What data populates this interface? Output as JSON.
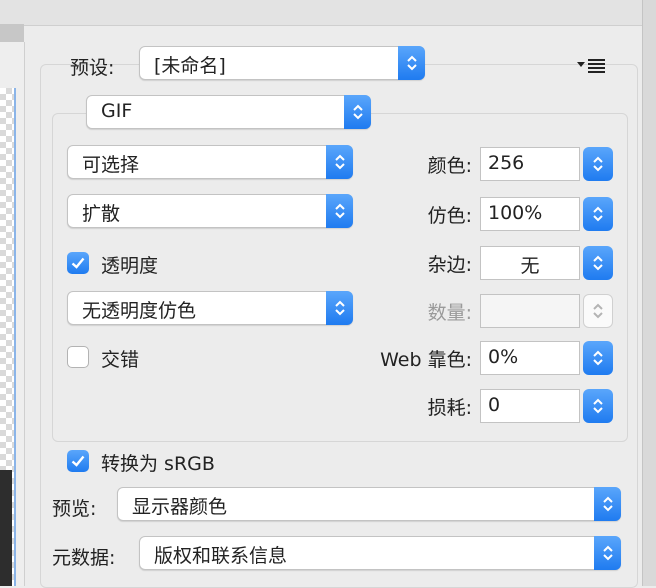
{
  "preset": {
    "label": "预设:",
    "value": "[未命名]"
  },
  "format": {
    "value": "GIF"
  },
  "reduction": {
    "value": "可选择"
  },
  "dither_algorithm": {
    "value": "扩散"
  },
  "transparency": {
    "label": "透明度",
    "checked": true
  },
  "transparency_dither": {
    "value": "无透明度仿色"
  },
  "interlaced": {
    "label": "交错",
    "checked": false
  },
  "colors": {
    "label": "颜色:",
    "value": "256"
  },
  "dither": {
    "label": "仿色:",
    "value": "100%"
  },
  "matte": {
    "label": "杂边:",
    "value": "无"
  },
  "amount": {
    "label": "数量:",
    "value": ""
  },
  "web_snap": {
    "label": "Web 靠色:",
    "value": "0%"
  },
  "lossy": {
    "label": "损耗:",
    "value": "0"
  },
  "convert_srgb": {
    "label": "转换为 sRGB",
    "checked": true
  },
  "preview": {
    "label": "预览:",
    "value": "显示器颜色"
  },
  "metadata": {
    "label": "元数据:",
    "value": "版权和联系信息"
  },
  "colors_theme": {
    "accent": "#1f7bf0"
  }
}
